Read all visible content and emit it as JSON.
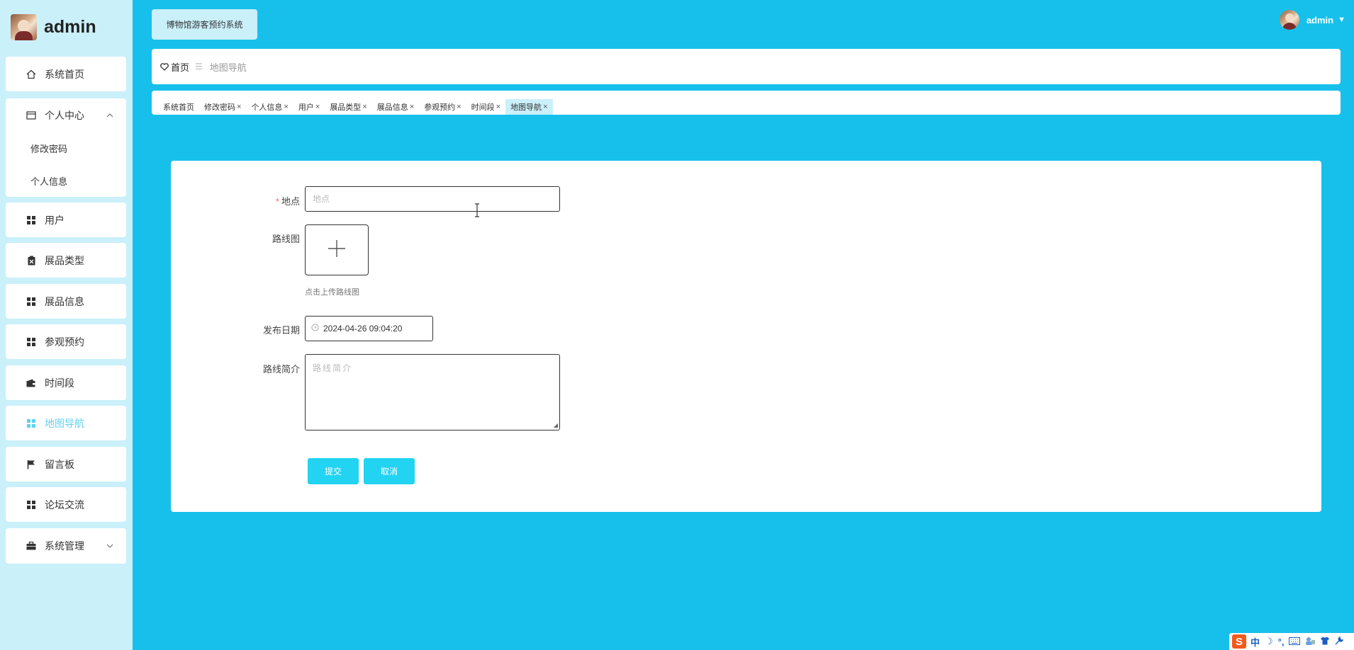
{
  "brand": {
    "name": "admin"
  },
  "sidebar": {
    "items": [
      {
        "label": "系统首页",
        "icon": "home-icon"
      },
      {
        "label": "个人中心",
        "icon": "card-icon",
        "children": [
          "修改密码",
          "个人信息"
        ]
      },
      {
        "label": "用户",
        "icon": "grid-icon"
      },
      {
        "label": "展品类型",
        "icon": "clipboard-icon"
      },
      {
        "label": "展品信息",
        "icon": "grid-icon"
      },
      {
        "label": "参观预约",
        "icon": "grid-icon"
      },
      {
        "label": "时间段",
        "icon": "wallet-icon"
      },
      {
        "label": "地图导航",
        "icon": "grid-icon",
        "active": true
      },
      {
        "label": "留言板",
        "icon": "flag-icon"
      },
      {
        "label": "论坛交流",
        "icon": "grid-icon"
      },
      {
        "label": "系统管理",
        "icon": "briefcase-icon"
      }
    ]
  },
  "header": {
    "system_title": "博物馆游客预约系统",
    "user": "admin"
  },
  "breadcrumb": {
    "home": "首页",
    "current": "地图导航"
  },
  "tabs": [
    {
      "label": "系统首页",
      "closable": false
    },
    {
      "label": "修改密码",
      "closable": true
    },
    {
      "label": "个人信息",
      "closable": true
    },
    {
      "label": "用户",
      "closable": true
    },
    {
      "label": "展品类型",
      "closable": true
    },
    {
      "label": "展品信息",
      "closable": true
    },
    {
      "label": "参观预约",
      "closable": true
    },
    {
      "label": "时间段",
      "closable": true
    },
    {
      "label": "地图导航",
      "closable": true,
      "active": true
    }
  ],
  "form": {
    "location_label": "地点",
    "location_placeholder": "地点",
    "route_image_label": "路线图",
    "upload_hint": "点击上传路线图",
    "publish_date_label": "发布日期",
    "publish_date_value": "2024-04-26 09:04:20",
    "route_intro_label": "路线简介",
    "route_intro_placeholder": "路线简介",
    "submit_label": "提交",
    "cancel_label": "取消"
  },
  "ime": {
    "lang": "中",
    "moon": "☽",
    "punct": "°,"
  },
  "colors": {
    "background": "#17c0eb",
    "sidebar": "#caf0fa",
    "accent": "#22d3f2",
    "active_text": "#5fd3f0"
  }
}
